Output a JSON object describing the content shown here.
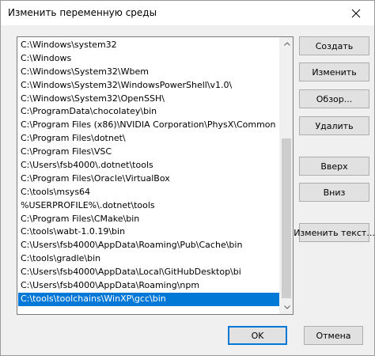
{
  "window": {
    "title": "Изменить переменную среды"
  },
  "paths": [
    "C:\\Windows\\system32",
    "C:\\Windows",
    "C:\\Windows\\System32\\Wbem",
    "C:\\Windows\\System32\\WindowsPowerShell\\v1.0\\",
    "C:\\Windows\\System32\\OpenSSH\\",
    "C:\\ProgramData\\chocolatey\\bin",
    "C:\\Program Files (x86)\\NVIDIA Corporation\\PhysX\\Common",
    "C:\\Program Files\\dotnet\\",
    "C:\\Program Files\\VSC",
    "C:\\Users\\fsb4000\\.dotnet\\tools",
    "C:\\Program Files\\Oracle\\VirtualBox",
    "C:\\tools\\msys64",
    "%USERPROFILE%\\.dotnet\\tools",
    "C:\\Program Files\\CMake\\bin",
    "C:\\tools\\wabt-1.0.19\\bin",
    "C:\\Users\\fsb4000\\AppData\\Roaming\\Pub\\Cache\\bin",
    "C:\\tools\\gradle\\bin",
    "C:\\Users\\fsb4000\\AppData\\Local\\GitHubDesktop\\bi",
    "C:\\Users\\fsb4000\\AppData\\Roaming\\npm",
    "C:\\tools\\toolchains\\WinXP\\gcc\\bin"
  ],
  "selected_index": 19,
  "buttons": {
    "create": "Создать",
    "edit": "Изменить",
    "browse": "Обзор...",
    "delete": "Удалить",
    "up": "Вверх",
    "down": "Вниз",
    "edit_text": "Изменить текст...",
    "ok": "OK",
    "cancel": "Отмена"
  },
  "colors": {
    "selection": "#0078d7",
    "primary_border": "#0078d7"
  },
  "icons": {
    "close": "close-icon",
    "scroll_up": "chevron-up-icon",
    "scroll_down": "chevron-down-icon"
  }
}
